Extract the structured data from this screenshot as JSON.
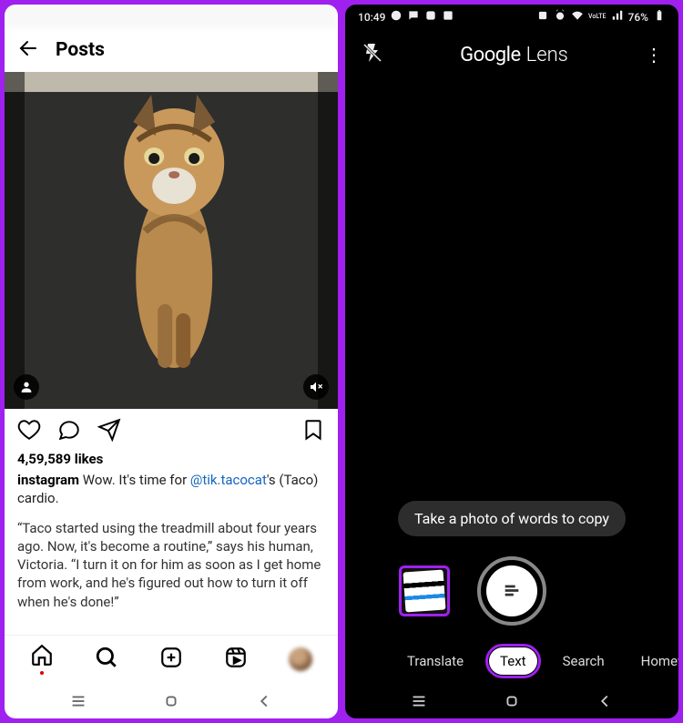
{
  "left": {
    "header_title": "Posts",
    "likes": "4,59,589 likes",
    "username": "instagram",
    "caption_part1": " Wow. It's time for ",
    "mention": "@tik.tacocat",
    "caption_part2": "'s (Taco) cardio.",
    "quote": "“Taco started using the treadmill about four years ago. Now, it's become a routine,” says his human, Victoria. “I turn it on for him as soon as I get home from work, and he's figured out how to turn it off when he's done!”"
  },
  "right": {
    "time": "10:49",
    "battery": "76%",
    "brand_g": "Google",
    "brand_lens": "Lens",
    "hint": "Take a photo of words to copy",
    "modes": {
      "translate": "Translate",
      "text": "Text",
      "search": "Search",
      "homework": "Homew"
    }
  }
}
